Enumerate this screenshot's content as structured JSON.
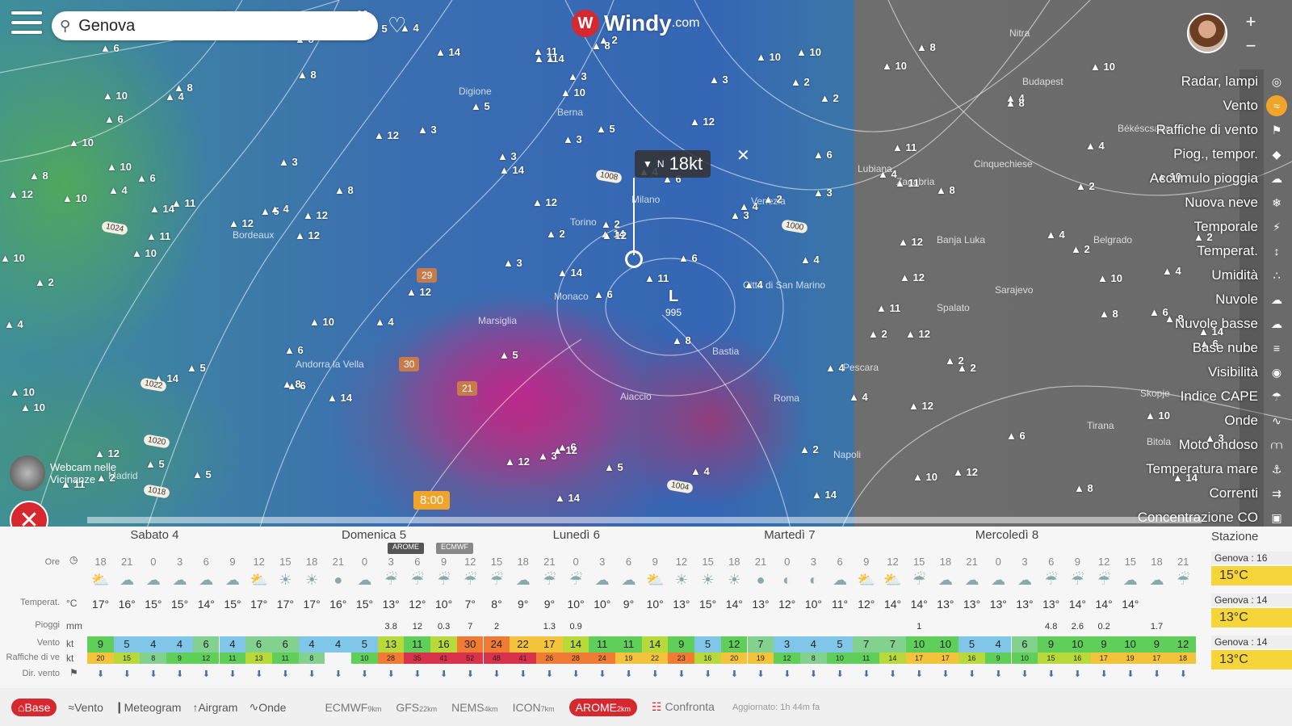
{
  "search": {
    "value": "Genova"
  },
  "logo": {
    "name": "Windy",
    "tld": ".com",
    "mark": "W"
  },
  "tooltip": {
    "direction": "N",
    "value": "18kt"
  },
  "time_badge": "8:00",
  "webcam": {
    "label": "Webcam nelle Vicinanze"
  },
  "map": {
    "places": [
      {
        "name": "Digione"
      },
      {
        "name": "Berna"
      },
      {
        "name": "Milano"
      },
      {
        "name": "Torino"
      },
      {
        "name": "Venezia"
      },
      {
        "name": "Bordeaux"
      },
      {
        "name": "Marsiglia"
      },
      {
        "name": "Monaco"
      },
      {
        "name": "Andorra la Vella"
      },
      {
        "name": "Madrid"
      },
      {
        "name": "Roma"
      },
      {
        "name": "Napoli"
      },
      {
        "name": "Lubiana"
      },
      {
        "name": "Zagabria"
      },
      {
        "name": "Banja Luka"
      },
      {
        "name": "Spalato"
      },
      {
        "name": "Sarajevo"
      },
      {
        "name": "Belgrado"
      },
      {
        "name": "Budapest"
      },
      {
        "name": "Cinquechiese"
      },
      {
        "name": "Città di San Marino"
      },
      {
        "name": "Aiaccio"
      },
      {
        "name": "Bastia"
      },
      {
        "name": "Pescara"
      },
      {
        "name": "Skopje"
      },
      {
        "name": "Bitola"
      },
      {
        "name": "Tirana"
      },
      {
        "name": "Nitra"
      },
      {
        "name": "Békéscsaba"
      }
    ],
    "pressures": [
      "1024",
      "1022",
      "1020",
      "1018",
      "1008",
      "1000",
      "1004"
    ],
    "low_center": {
      "label": "L",
      "value": "995"
    },
    "gust_badges": [
      "29",
      "30",
      "21"
    ]
  },
  "layers": [
    {
      "label": "Radar, lampi",
      "icon": "radar-icon"
    },
    {
      "label": "Vento",
      "icon": "wind-icon",
      "active": true
    },
    {
      "label": "Raffiche di vento",
      "icon": "gust-flag-icon"
    },
    {
      "label": "Piog., tempor.",
      "icon": "drop-icon"
    },
    {
      "label": "Accumulo pioggia",
      "icon": "rain-accumulation-icon"
    },
    {
      "label": "Nuova neve",
      "icon": "snowflake-icon"
    },
    {
      "label": "Temporale",
      "icon": "thunderstorm-icon"
    },
    {
      "label": "Temperat.",
      "icon": "thermometer-icon"
    },
    {
      "label": "Umidità",
      "icon": "humidity-icon"
    },
    {
      "label": "Nuvole",
      "icon": "cloud-icon"
    },
    {
      "label": "Nuvole basse",
      "icon": "low-cloud-icon"
    },
    {
      "label": "Base nube",
      "icon": "cloud-base-icon"
    },
    {
      "label": "Visibilità",
      "icon": "eye-icon"
    },
    {
      "label": "Indice CAPE",
      "icon": "cape-icon"
    },
    {
      "label": "Onde",
      "icon": "waves-icon"
    },
    {
      "label": "Moto ondoso",
      "icon": "swell-icon"
    },
    {
      "label": "Temperatura mare",
      "icon": "sea-temp-icon"
    },
    {
      "label": "Correnti",
      "icon": "currents-icon"
    },
    {
      "label": "Concentrazione CO",
      "icon": "co-icon"
    }
  ],
  "forecast": {
    "days": [
      "Sabato 4",
      "Domenica 5",
      "Lunedì 6",
      "Martedì 7",
      "Mercoledì 8"
    ],
    "row_labels": {
      "hours": "Ore",
      "temp": "Temperat.",
      "rain": "Pioggi",
      "wind": "Vento",
      "gust": "Raffiche di ve",
      "dir": "Dir. vento"
    },
    "units": {
      "temp": "°C",
      "rain": "mm",
      "wind": "kt",
      "gust": "kt"
    },
    "hours": [
      "18",
      "21",
      "0",
      "3",
      "6",
      "9",
      "12",
      "15",
      "18",
      "21",
      "0",
      "3",
      "6",
      "9",
      "12",
      "15",
      "18",
      "21",
      "0",
      "3",
      "6",
      "9",
      "12",
      "15",
      "18",
      "21",
      "0",
      "3",
      "6",
      "9",
      "12",
      "15",
      "18",
      "21",
      "0",
      "3",
      "6",
      "9",
      "12",
      "15",
      "18",
      "21"
    ],
    "temps": [
      "17°",
      "16°",
      "15°",
      "15°",
      "14°",
      "15°",
      "17°",
      "17°",
      "17°",
      "16°",
      "15°",
      "13°",
      "12°",
      "10°",
      "7°",
      "8°",
      "9°",
      "9°",
      "10°",
      "10°",
      "9°",
      "10°",
      "13°",
      "15°",
      "14°",
      "13°",
      "12°",
      "10°",
      "11°",
      "12°",
      "14°",
      "14°",
      "13°",
      "13°",
      "13°",
      "13°",
      "13°",
      "14°",
      "14°",
      "14°"
    ],
    "rain": [
      "",
      "",
      "",
      "",
      "",
      "",
      "",
      "",
      "",
      "",
      "",
      "3.8",
      "12",
      "0.3",
      "7",
      "2",
      "",
      "1.3",
      "0.9",
      "",
      "",
      "",
      "",
      "",
      "",
      "",
      "",
      "",
      "",
      "",
      "",
      "1",
      "",
      "",
      "",
      "",
      "4.8",
      "2.6",
      "0.2",
      "",
      "1.7"
    ],
    "wind": [
      "9",
      "5",
      "4",
      "4",
      "6",
      "4",
      "6",
      "6",
      "4",
      "4",
      "5",
      "13",
      "11",
      "16",
      "30",
      "24",
      "22",
      "17",
      "14",
      "11",
      "11",
      "14",
      "9",
      "5",
      "12",
      "7",
      "3",
      "4",
      "5",
      "7",
      "7",
      "10",
      "10",
      "5",
      "4",
      "6",
      "9",
      "10",
      "9",
      "10",
      "9",
      "12"
    ],
    "gust": [
      "20",
      "15",
      "8",
      "9",
      "12",
      "11",
      "13",
      "11",
      "8",
      "",
      "10",
      "28",
      "35",
      "41",
      "52",
      "48",
      "41",
      "26",
      "28",
      "24",
      "19",
      "22",
      "23",
      "16",
      "20",
      "19",
      "12",
      "8",
      "10",
      "11",
      "14",
      "17",
      "17",
      "16",
      "9",
      "10",
      "15",
      "16",
      "17",
      "19",
      "17",
      "18"
    ],
    "wx_icons": [
      "partly-cloudy-icon",
      "cloudy-icon",
      "cloudy-icon",
      "cloudy-icon",
      "cloudy-icon",
      "cloudy-icon",
      "partly-sunny-icon",
      "sunny-icon",
      "sunny-icon",
      "clear-night-icon",
      "cloudy-icon",
      "rain-icon",
      "rain-icon",
      "rain-icon",
      "rain-icon",
      "rain-icon",
      "cloudy-icon",
      "rain-icon",
      "rain-icon",
      "cloudy-icon",
      "cloudy-icon",
      "partly-sunny-icon",
      "sunny-icon",
      "sunny-icon",
      "sunny-icon",
      "clear-night-icon",
      "moon-icon",
      "moon-icon",
      "cloudy-icon",
      "partly-sunny-icon",
      "partly-sunny-icon",
      "rain-icon",
      "cloudy-icon",
      "cloudy-icon",
      "cloudy-icon",
      "cloudy-icon",
      "rain-icon",
      "rain-icon",
      "rain-icon",
      "cloudy-icon",
      "cloudy-icon",
      "rain-icon"
    ],
    "model_bands": [
      "AROME",
      "ECMWF"
    ]
  },
  "stations": {
    "title": "Stazione",
    "items": [
      {
        "name": "Genova : 16",
        "value": "15°C"
      },
      {
        "name": "Genova : 14",
        "value": "13°C"
      },
      {
        "name": "Genova : 14",
        "value": "13°C"
      }
    ]
  },
  "bottombar": {
    "tabs": [
      {
        "label": "Base",
        "active": true,
        "icon": "base-icon"
      },
      {
        "label": "Vento",
        "icon": "wind-icon"
      },
      {
        "label": "Meteogram",
        "icon": "meteogram-icon"
      },
      {
        "label": "Airgram",
        "icon": "airgram-icon"
      },
      {
        "label": "Onde",
        "icon": "waves-icon"
      }
    ],
    "models": [
      {
        "label": "ECMWF",
        "res": "9km"
      },
      {
        "label": "GFS",
        "res": "22km"
      },
      {
        "label": "NEMS",
        "res": "4km"
      },
      {
        "label": "ICON",
        "res": "7km"
      },
      {
        "label": "AROME",
        "res": "2km",
        "active": true
      }
    ],
    "compare": "Confronta",
    "updated": "Aggiornato: 1h 44m fa"
  },
  "colors": {
    "accent": "#d6282e",
    "active_layer": "#f0a52a",
    "station_value": "#f6d53a"
  }
}
